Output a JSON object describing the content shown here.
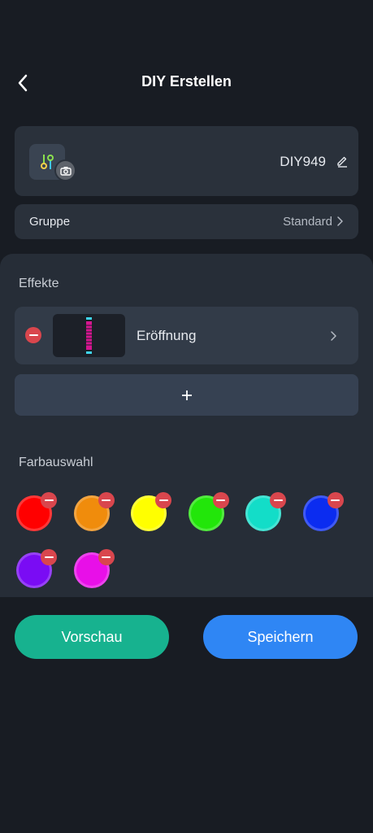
{
  "header": {
    "title": "DIY Erstellen",
    "back_icon": "chevron-left-icon"
  },
  "diy": {
    "name": "DIY949",
    "icon": "diy-sliders-icon",
    "camera_icon": "camera-icon",
    "edit_icon": "pencil-icon"
  },
  "group": {
    "label": "Gruppe",
    "value": "Standard"
  },
  "effects": {
    "title": "Effekte",
    "items": [
      {
        "name": "Eröffnung"
      }
    ],
    "add_label": "+"
  },
  "colors": {
    "title": "Farbauswahl",
    "swatches": [
      {
        "color": "#ff0000"
      },
      {
        "color": "#f08c0c"
      },
      {
        "color": "#ffff00"
      },
      {
        "color": "#22e60a"
      },
      {
        "color": "#13ddc8"
      },
      {
        "color": "#0b2cf0"
      },
      {
        "color": "#7a0cf4"
      },
      {
        "color": "#e80fe8"
      }
    ]
  },
  "actions": {
    "preview_label": "Vorschau",
    "save_label": "Speichern"
  },
  "theme": {
    "preview": "#17b28f",
    "save": "#2f86f4",
    "danger": "#d9464d"
  }
}
